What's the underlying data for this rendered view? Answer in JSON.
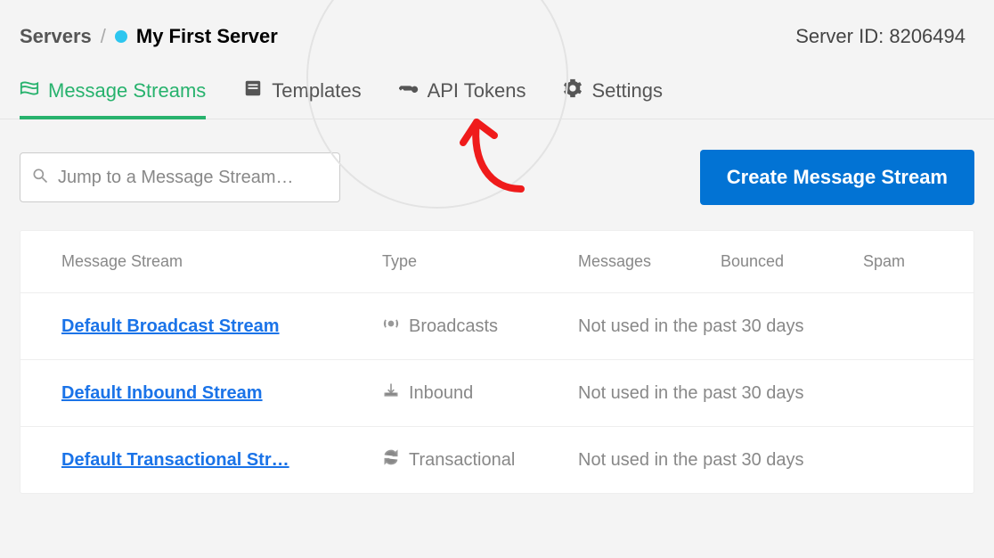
{
  "breadcrumb": {
    "root": "Servers",
    "current": "My First Server"
  },
  "server_id": {
    "label": "Server ID:",
    "value": "8206494"
  },
  "tabs": {
    "message_streams": "Message Streams",
    "templates": "Templates",
    "api_tokens": "API Tokens",
    "settings": "Settings"
  },
  "search": {
    "placeholder": "Jump to a Message Stream…"
  },
  "buttons": {
    "create": "Create Message Stream"
  },
  "table": {
    "headers": {
      "stream": "Message Stream",
      "type": "Type",
      "messages": "Messages",
      "bounced": "Bounced",
      "spam": "Spam"
    },
    "rows": [
      {
        "name": "Default Broadcast Stream",
        "type": "Broadcasts",
        "status": "Not used in the past 30 days"
      },
      {
        "name": "Default Inbound Stream",
        "type": "Inbound",
        "status": "Not used in the past 30 days"
      },
      {
        "name": "Default Transactional Str…",
        "type": "Transactional",
        "status": "Not used in the past 30 days"
      }
    ]
  }
}
